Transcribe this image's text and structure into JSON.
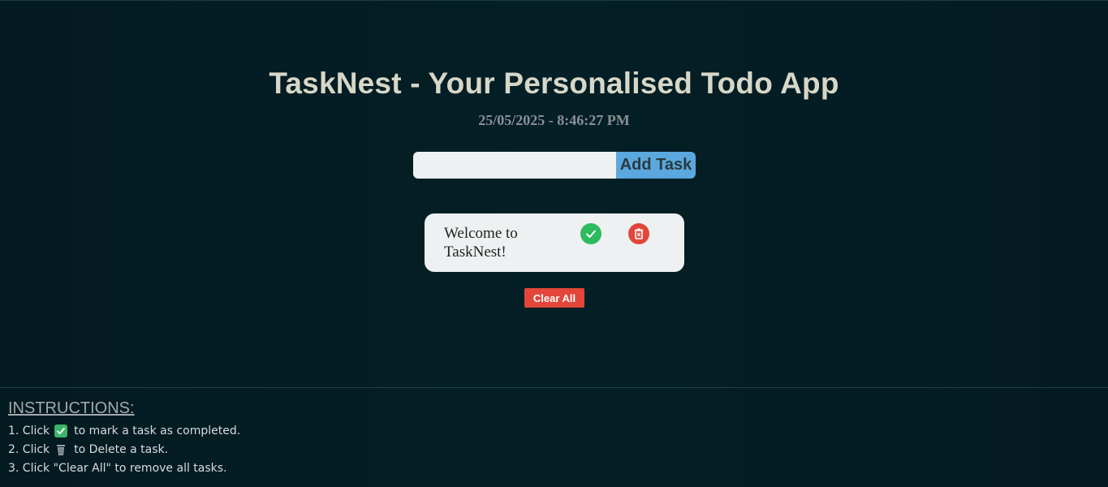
{
  "app": {
    "title": "TaskNest - Your Personalised Todo App",
    "datetime": "25/05/2025 - 8:46:27 PM"
  },
  "input": {
    "value": "",
    "placeholder": "",
    "add_label": "Add Task"
  },
  "tasks": [
    {
      "text": "Welcome to TaskNest!",
      "complete_icon": "check-circle-icon",
      "delete_icon": "trash-icon"
    }
  ],
  "clear_all_label": "Clear All",
  "instructions": {
    "title": "INSTRUCTIONS:",
    "step1_prefix": "1. Click",
    "step1_suffix": "to mark a task as completed.",
    "step2_prefix": "2. Click",
    "step2_suffix": "to Delete a task.",
    "step3": "3. Click \"Clear All\" to remove all tasks."
  },
  "colors": {
    "background": "#031a20",
    "title": "#d7d7c8",
    "add_button": "#5aa8dd",
    "complete": "#2dbb5f",
    "delete": "#e2463a"
  }
}
